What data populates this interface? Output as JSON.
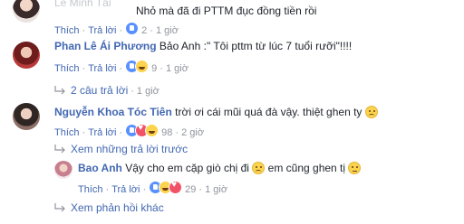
{
  "comments": [
    {
      "author": "Lê Minh Tài",
      "text": "Nhỏ mà đã đi PTTM đục đồng tiền rồi",
      "like_label": "Thích",
      "reply_label": "Trả lời",
      "reaction_count": "2",
      "time": "1 giờ"
    },
    {
      "author": "Phan Lê Ái Phương",
      "text": "Bảo Anh :\" Tôi pttm từ lúc 7 tuổi rưỡi\"!!!!",
      "like_label": "Thích",
      "reply_label": "Trả lời",
      "reaction_count": "9",
      "time": "1 giờ",
      "replies_link": "2 câu trả lời",
      "replies_time": "1 giờ"
    },
    {
      "author": "Nguyễn Khoa Tóc Tiên",
      "text": "trời ơi cái mũi quá đà vậy. thiệt ghen ty",
      "like_label": "Thích",
      "reply_label": "Trả lời",
      "reaction_count": "98",
      "time": "2 giờ",
      "earlier_replies_link": "Xem những trả lời trước",
      "reply": {
        "author": "Bao Anh",
        "text_part1": "Vậy cho em cặp giò chị đi",
        "text_part2": "em cũng ghen tị",
        "like_label": "Thích",
        "reply_label": "Trả lời",
        "reaction_count": "29",
        "time": "1 giờ"
      },
      "more_replies_link": "Xem phản hồi khác"
    }
  ]
}
